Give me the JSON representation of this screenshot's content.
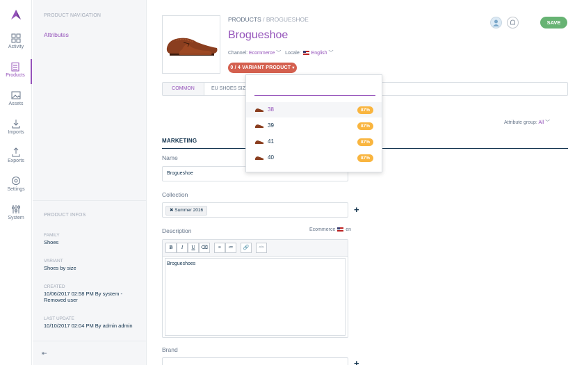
{
  "colors": {
    "accent": "#9452ba",
    "save": "#67b373",
    "variant": "#d4604f",
    "completeness": "#f9b53f"
  },
  "menu": [
    {
      "label": "Activity",
      "icon": "activity-icon"
    },
    {
      "label": "Products",
      "icon": "products-icon",
      "active": true
    },
    {
      "label": "Assets",
      "icon": "assets-icon"
    },
    {
      "label": "Imports",
      "icon": "imports-icon"
    },
    {
      "label": "Exports",
      "icon": "exports-icon"
    },
    {
      "label": "Settings",
      "icon": "settings-icon"
    },
    {
      "label": "System",
      "icon": "system-icon"
    }
  ],
  "product_nav": {
    "title": "PRODUCT NAVIGATION",
    "link": "Attributes"
  },
  "product_infos": {
    "title": "PRODUCT INFOS",
    "family_label": "FAMILY",
    "family": "Shoes",
    "variant_label": "VARIANT",
    "variant": "Shoes by size",
    "created_label": "CREATED",
    "created": "10/06/2017 02:58 PM By system - Removed user",
    "updated_label": "LAST UPDATE",
    "updated": "10/10/2017 02:04 PM By admin admin"
  },
  "header": {
    "breadcrumb_root": "PRODUCTS",
    "breadcrumb_sep": "/",
    "breadcrumb_current": "BROGUESHOE",
    "title": "Brogueshoe",
    "channel_label": "Channel:",
    "channel_value": "Ecommerce",
    "locale_label": "Locale:",
    "locale_value": "English",
    "variant_button": "0 / 4 VARIANT PRODUCT",
    "save": "SAVE"
  },
  "tabs": {
    "common": "COMMON",
    "eu": "EU SHOES SIZE"
  },
  "attribute_group": {
    "label": "Attribute group:",
    "value": "All"
  },
  "section": "MARKETING",
  "fields": {
    "name_label": "Name",
    "name_value": "Brogueshoe",
    "collection_label": "Collection",
    "collection_chip": "Summer 2016",
    "description_label": "Description",
    "description_scope": "Ecommerce",
    "description_locale": "en",
    "description_value": "Brogueshoes",
    "brand_label": "Brand"
  },
  "toolbar": [
    "B",
    "I",
    "U",
    "⌫",
    "≡",
    "≔",
    "🔗",
    "</>"
  ],
  "variants": [
    {
      "label": "38",
      "completeness": "87%",
      "selected": true
    },
    {
      "label": "39",
      "completeness": "87%"
    },
    {
      "label": "41",
      "completeness": "87%"
    },
    {
      "label": "40",
      "completeness": "87%"
    }
  ]
}
